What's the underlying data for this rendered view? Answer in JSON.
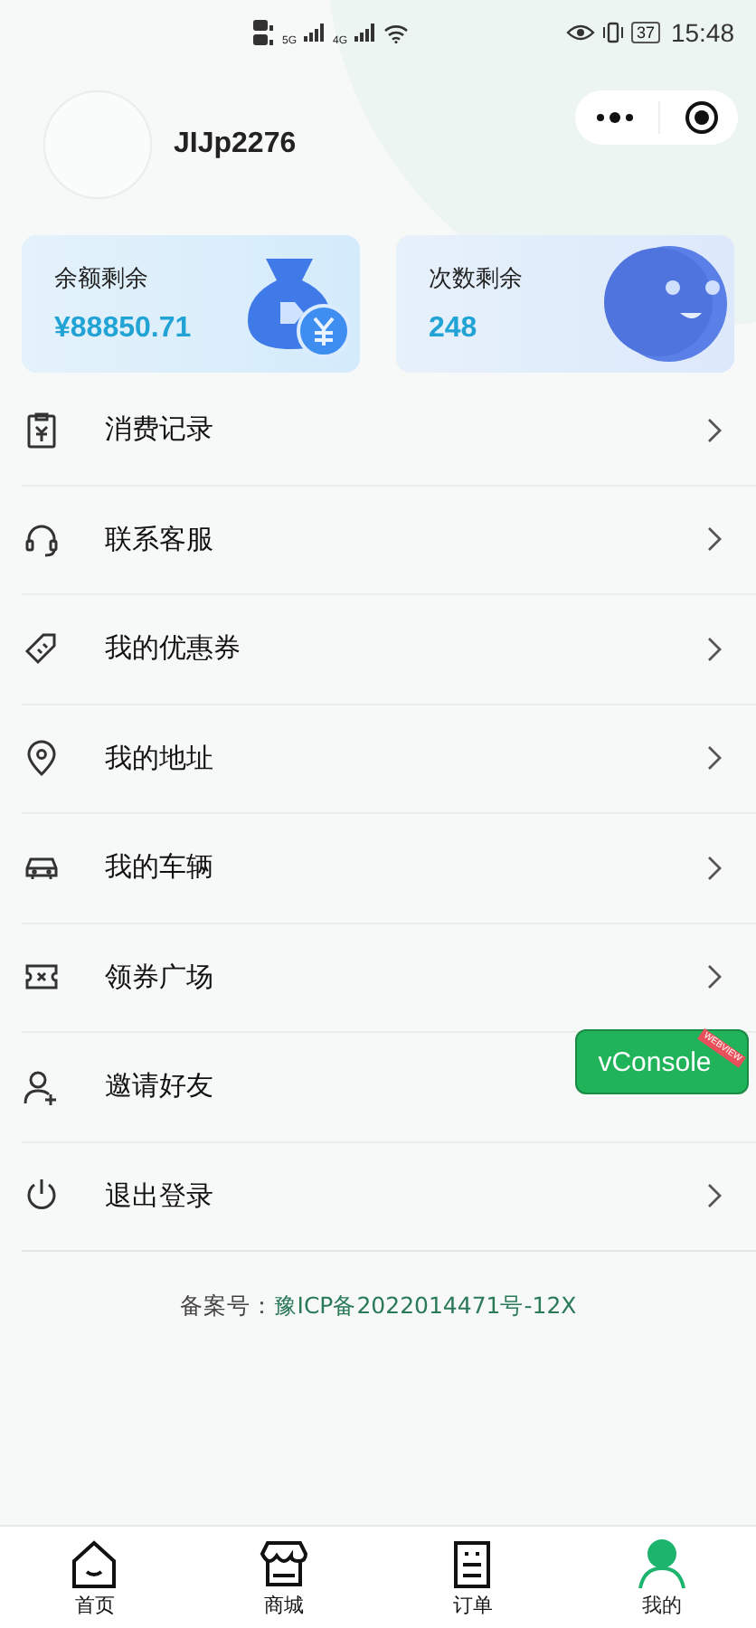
{
  "status_bar": {
    "time": "15:48",
    "battery": "37",
    "net_labels": [
      "5G",
      "4G"
    ]
  },
  "profile": {
    "username": "JIJp2276"
  },
  "stats": [
    {
      "kind": "balance",
      "label": "余额剩余",
      "value": "¥88850.71"
    },
    {
      "kind": "count",
      "label": "次数剩余",
      "value": "248"
    }
  ],
  "menu": [
    {
      "kind": "receipt",
      "label": "消费记录",
      "has_arrow": true
    },
    {
      "kind": "headset",
      "label": "联系客服",
      "has_arrow": true
    },
    {
      "kind": "coupon",
      "label": "我的优惠券",
      "has_arrow": true
    },
    {
      "kind": "location",
      "label": "我的地址",
      "has_arrow": true
    },
    {
      "kind": "car",
      "label": "我的车辆",
      "has_arrow": true
    },
    {
      "kind": "ticket",
      "label": "领券广场",
      "has_arrow": true
    },
    {
      "kind": "invite",
      "label": "邀请好友",
      "has_arrow": false
    },
    {
      "kind": "power",
      "label": "退出登录",
      "has_arrow": true
    }
  ],
  "icp": {
    "label": "备案号：",
    "link": "豫ICP备2022014471号-12X"
  },
  "vconsole": {
    "label": "vConsole",
    "ribbon": "WEBVIEW"
  },
  "tabbar": [
    {
      "kind": "home",
      "label": "首页",
      "selected": false
    },
    {
      "kind": "shop",
      "label": "商城",
      "selected": false
    },
    {
      "kind": "order",
      "label": "订单",
      "selected": false
    },
    {
      "kind": "me",
      "label": "我的",
      "selected": true
    }
  ]
}
